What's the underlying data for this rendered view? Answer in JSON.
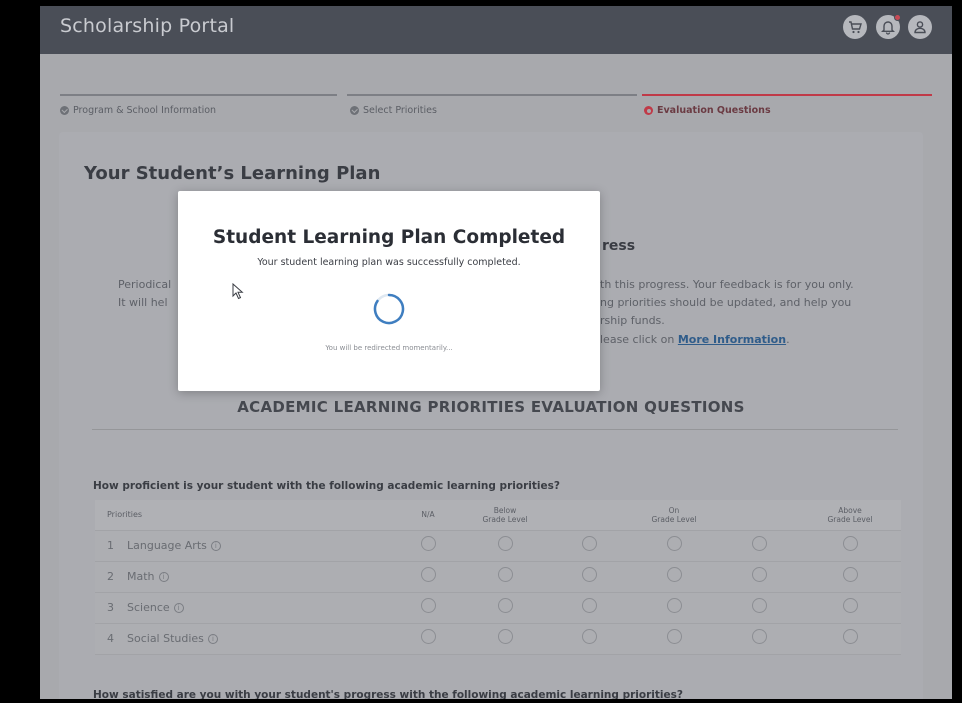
{
  "app": {
    "title": "Scholarship Portal"
  },
  "header": {
    "icons": [
      "cart-icon",
      "bell-icon",
      "user-icon"
    ],
    "notification_badge": true
  },
  "stepper": {
    "steps": [
      {
        "label": "Program & School Information",
        "state": "done"
      },
      {
        "label": "Select Priorities",
        "state": "done"
      },
      {
        "label": "Evaluation Questions",
        "state": "current"
      }
    ]
  },
  "plan": {
    "title": "Your Student’s Learning Plan",
    "progress_heading_fragment": "ress",
    "intro_left": [
      "Periodical",
      "It will hel"
    ],
    "intro_right": [
      "th this progress. Your feedback is for you only.",
      "ng priorities should be updated, and help you",
      "rship funds.",
      "lease click on"
    ],
    "more_info_link": "More Information",
    "more_info_suffix": "."
  },
  "section": {
    "title": "ACADEMIC LEARNING PRIORITIES EVALUATION QUESTIONS"
  },
  "questions": {
    "q1": "How proficient is your student with the following academic learning priorities?",
    "q2": "How satisfied are you with your student's progress with the following academic learning priorities?"
  },
  "table": {
    "headers": {
      "priorities": "Priorities",
      "na": "N/A",
      "below_1": "Below",
      "below_2": "Grade Level",
      "on_1": "On",
      "on_2": "Grade Level",
      "above_1": "Above",
      "above_2": "Grade Level"
    },
    "rows": [
      {
        "num": "1",
        "label": "Language Arts"
      },
      {
        "num": "2",
        "label": "Math"
      },
      {
        "num": "3",
        "label": "Science"
      },
      {
        "num": "4",
        "label": "Social Studies"
      }
    ],
    "info_glyph": "i"
  },
  "modal": {
    "title": "Student Learning Plan Completed",
    "message": "Your student learning plan was successfully completed.",
    "note": "You will be redirected momentarily..."
  }
}
